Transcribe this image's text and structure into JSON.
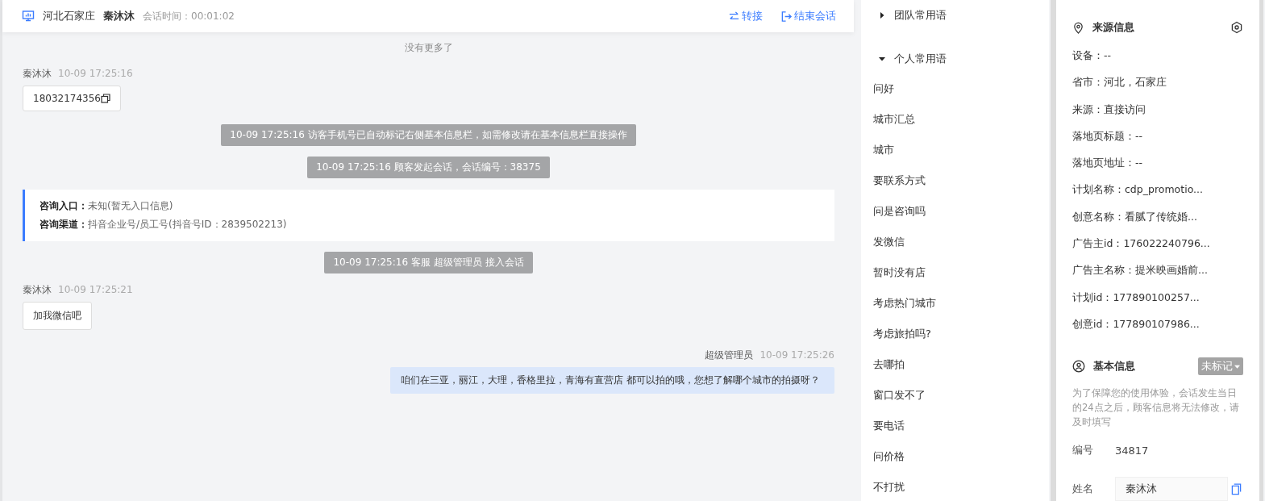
{
  "header": {
    "location": "河北石家庄",
    "visitor": "秦沐沐",
    "duration": "会话时间：00:01:02",
    "actions": [
      {
        "kind": "transfer",
        "label": "转接"
      },
      {
        "kind": "end",
        "label": "结束会话"
      }
    ]
  },
  "messages": [
    {
      "kind": "notice",
      "text": "没有更多了"
    },
    {
      "kind": "customer",
      "sender": "秦沐沐",
      "time": "10-09 17:25:16",
      "text": "18032174356",
      "copyable": true
    },
    {
      "kind": "system",
      "text": "10-09 17:25:16 访客手机号已自动标记右侧基本信息栏，如需修改请在基本信息栏直接操作"
    },
    {
      "kind": "system",
      "text": "10-09 17:25:16 顾客发起会话，会话编号：38375"
    },
    {
      "kind": "entry",
      "lines": [
        {
          "label": "咨询入口：",
          "value": "未知(暂无入口信息)"
        },
        {
          "label": "咨询渠道：",
          "value": "抖音企业号/员工号(抖音号ID：2839502213)"
        }
      ]
    },
    {
      "kind": "system",
      "text": "10-09 17:25:16 客服 超级管理员 接入会话"
    },
    {
      "kind": "customer",
      "sender": "秦沐沐",
      "time": "10-09 17:25:21",
      "text": "加我微信吧",
      "copyable": false
    },
    {
      "kind": "agent",
      "sender": "超级管理员",
      "time": "10-09 17:25:26",
      "text": "咱们在三亚，丽江，大理，香格里拉，青海有直营店 都可以拍的哦，您想了解哪个城市的拍摄呀？"
    }
  ],
  "phrases": [
    {
      "label": "团队常用语",
      "expanded": false
    },
    {
      "label": "个人常用语",
      "expanded": true,
      "children": [
        "问好",
        "城市汇总",
        "城市",
        "要联系方式",
        "问是咨询吗",
        "发微信",
        "暂时没有店",
        "考虑热门城市",
        "考虑旅拍吗?",
        "去哪拍",
        "窗口发不了",
        "要电话",
        "问价格",
        "不打扰"
      ]
    }
  ],
  "source_info": {
    "title": "来源信息",
    "fields": [
      "设备：--",
      "省市：河北，石家庄",
      "来源：直接访问",
      "落地页标题：--",
      "落地页地址：--",
      "计划名称：cdp_promotio...",
      "创意名称：看腻了传统婚...",
      "广告主id：176022240796...",
      "广告主名称：提米映画婚前...",
      "计划id：177890100257...",
      "创意id：177890107986..."
    ]
  },
  "basic_info": {
    "title": "基本信息",
    "tag": "未标记",
    "note": "为了保障您的使用体验，会话发生当日的24点之后，顾客信息将无法修改，请及时填写",
    "fields": [
      {
        "kind": "text",
        "label": "编号",
        "value": "34817"
      },
      {
        "kind": "input",
        "label": "姓名",
        "value": "秦沐沐"
      }
    ]
  }
}
